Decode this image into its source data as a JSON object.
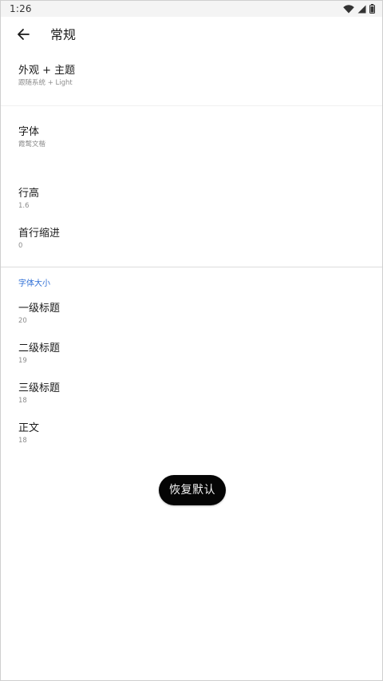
{
  "status_bar": {
    "time": "1:26",
    "icons": [
      "wifi-icon",
      "cellular-signal-icon",
      "battery-icon"
    ]
  },
  "app_bar": {
    "back_icon": "arrow-left-icon",
    "title": "常规"
  },
  "settings": {
    "appearance": {
      "label": "外观 + 主题",
      "value": "跟随系统 + Light"
    },
    "font": {
      "label": "字体",
      "value": "霞鹜文楷"
    },
    "line_height": {
      "label": "行高",
      "value": "1.6"
    },
    "first_line_indent": {
      "label": "首行缩进",
      "value": "0"
    }
  },
  "font_size_section": {
    "header": "字体大小",
    "items": [
      {
        "label": "一级标题",
        "value": "20"
      },
      {
        "label": "二级标题",
        "value": "19"
      },
      {
        "label": "三级标题",
        "value": "18"
      },
      {
        "label": "正文",
        "value": "18"
      }
    ]
  },
  "restore_button": {
    "label": "恢复默认"
  },
  "colors": {
    "accent": "#2f6fd6",
    "button_bg": "#050505",
    "text_primary": "#1a1a1a",
    "text_secondary": "#8c8c8c"
  }
}
